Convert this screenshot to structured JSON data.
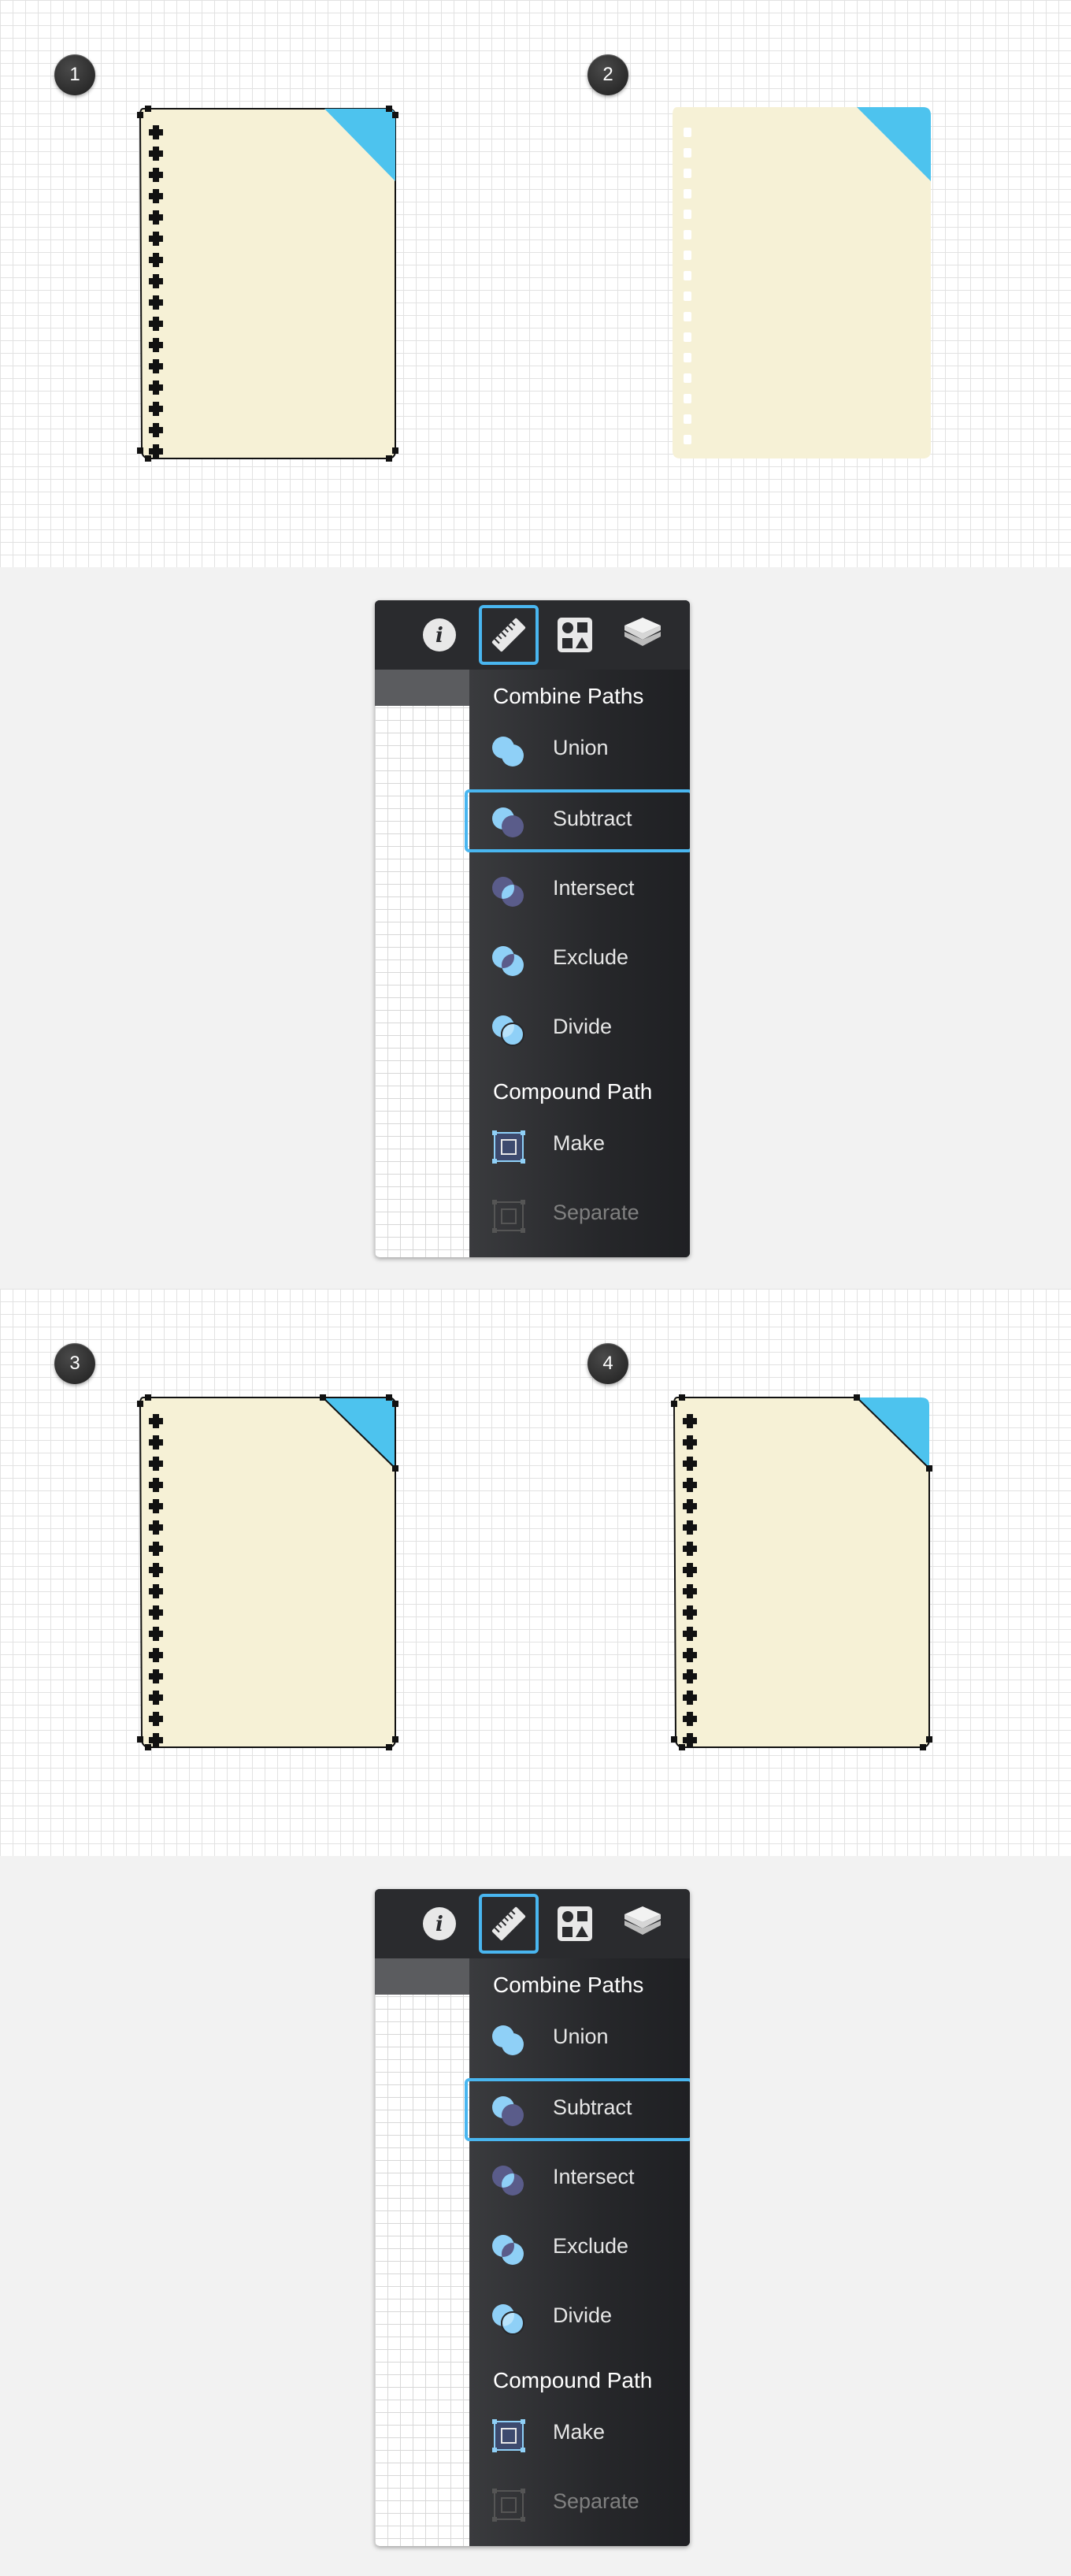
{
  "steps": {
    "step1": "1",
    "step2": "2",
    "step3": "3",
    "step4": "4"
  },
  "colors": {
    "paper": "#f6f1d6",
    "corner": "#4dc3ee",
    "accent": "#49b6f0",
    "panel_dark": "#1f2023"
  },
  "inspector_top": {
    "tools": [
      {
        "icon": "info-icon"
      },
      {
        "icon": "ruler-icon"
      },
      {
        "icon": "shapes-icon"
      },
      {
        "icon": "layers-icon"
      }
    ],
    "section_combine": "Combine Paths",
    "items": [
      {
        "label": "Union",
        "icon": "union-icon"
      },
      {
        "label": "Subtract",
        "icon": "subtract-icon"
      },
      {
        "label": "Intersect",
        "icon": "intersect-icon"
      },
      {
        "label": "Exclude",
        "icon": "exclude-icon"
      },
      {
        "label": "Divide",
        "icon": "divide-icon"
      }
    ],
    "section_compound": "Compound Path",
    "compound_items": [
      {
        "label": "Make",
        "icon": "make-icon"
      },
      {
        "label": "Separate",
        "icon": "separate-icon"
      }
    ]
  },
  "inspector_bottom": {
    "section_combine": "Combine Paths",
    "items": [
      {
        "label": "Union"
      },
      {
        "label": "Subtract"
      },
      {
        "label": "Intersect"
      },
      {
        "label": "Exclude"
      },
      {
        "label": "Divide"
      }
    ],
    "section_compound": "Compound Path",
    "compound_items": [
      {
        "label": "Make"
      },
      {
        "label": "Separate"
      }
    ]
  }
}
